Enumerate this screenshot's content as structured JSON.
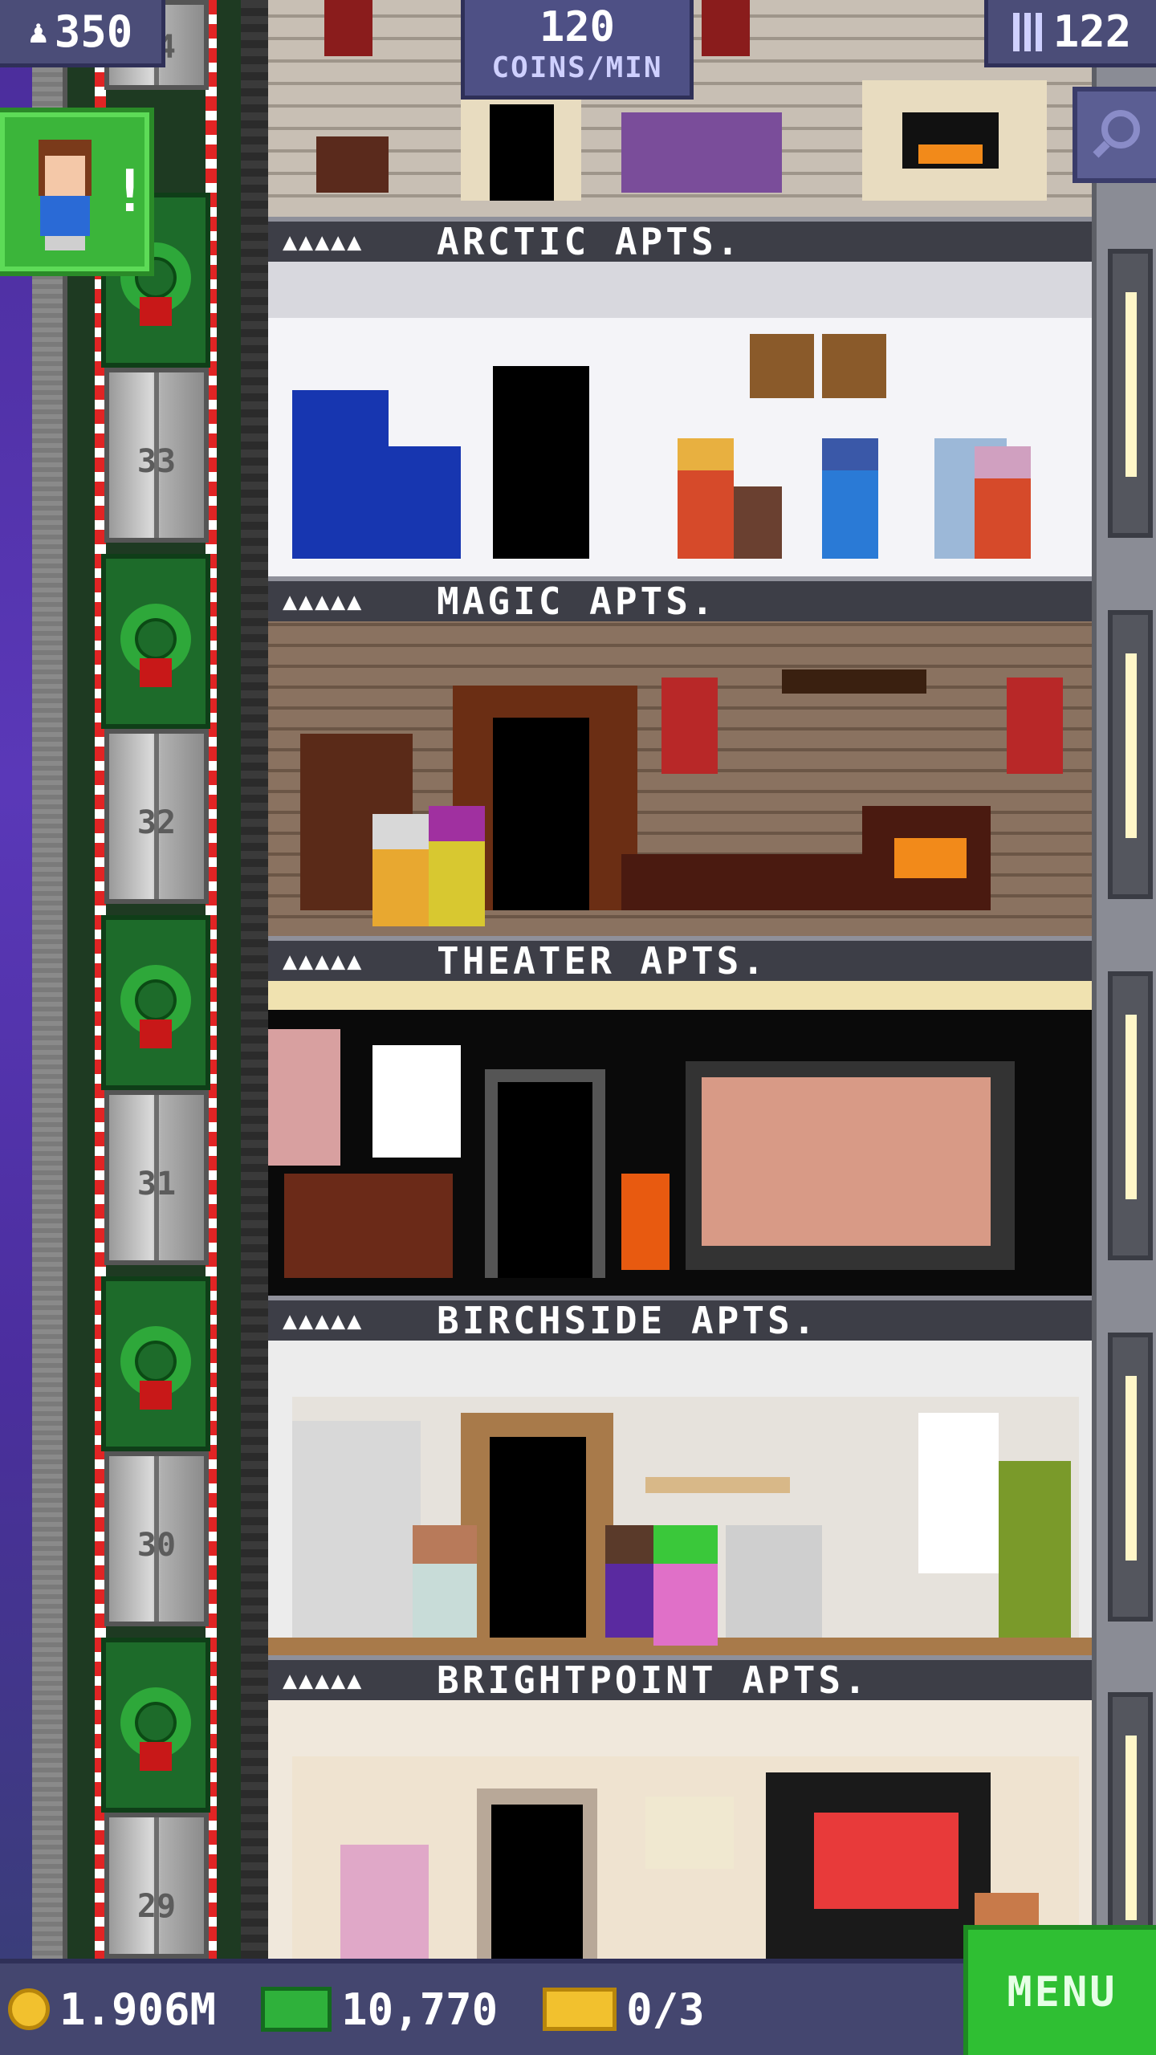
{
  "hud": {
    "residents": "350",
    "coins_per_min_value": "120",
    "coins_per_min_label": "COINS/MIN",
    "floors": "122",
    "coins": "1.906M",
    "bux": "10,770",
    "tickets": "0/3",
    "menu_label": "MENU"
  },
  "icons": {
    "residents": "person-icon",
    "floors": "building-icon",
    "search": "magnifier-icon",
    "coins": "coin-icon",
    "bux": "bux-icon",
    "tickets": "ticket-icon",
    "notify": "bitizen-alert-icon"
  },
  "notification": {
    "mark": "!"
  },
  "elevator": {
    "floors": [
      "34",
      "33",
      "32",
      "31",
      "30",
      "29"
    ]
  },
  "floors": [
    {
      "stars": "▲▲▲▲▲",
      "name": "ARCTIC APTS."
    },
    {
      "stars": "▲▲▲▲▲",
      "name": "MAGIC APTS."
    },
    {
      "stars": "▲▲▲▲▲",
      "name": "THEATER APTS."
    },
    {
      "stars": "▲▲▲▲▲",
      "name": "BIRCHSIDE APTS."
    },
    {
      "stars": "▲▲▲▲▲",
      "name": "BRIGHTPOINT APTS."
    }
  ],
  "colors": {
    "accent_green": "#2fbf33",
    "hud_bg": "#44466f",
    "candy_red": "#e12424"
  }
}
